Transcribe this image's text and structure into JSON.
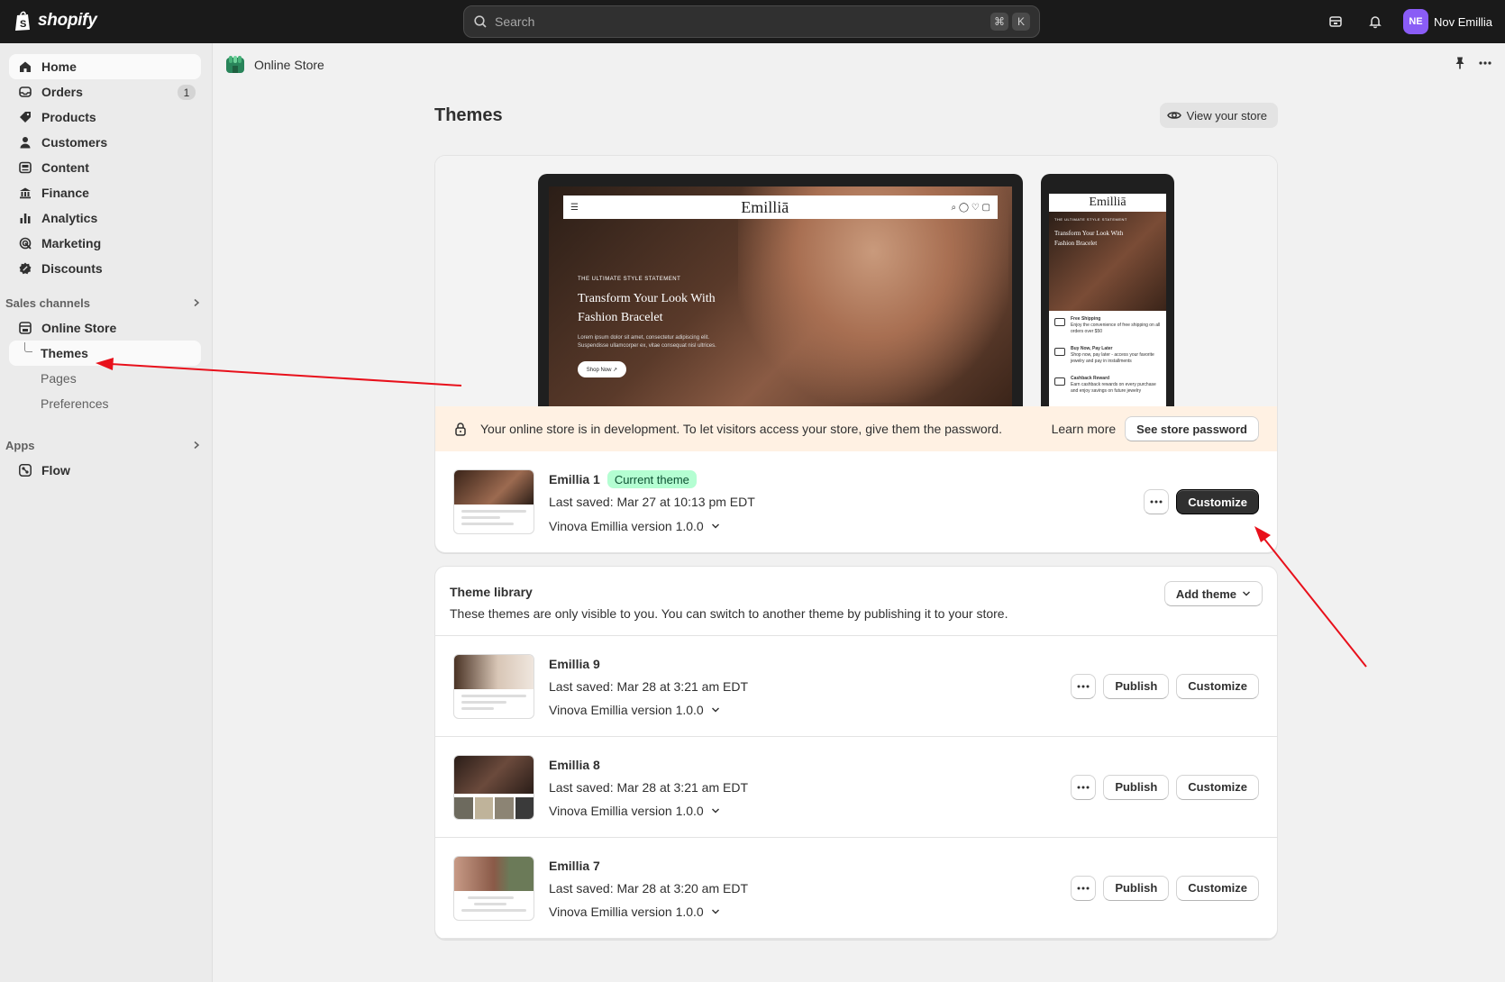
{
  "topbar": {
    "brand": "shopify",
    "search_placeholder": "Search",
    "shortcut_keys": [
      "⌘",
      "K"
    ],
    "user_initials": "NE",
    "user_name": "Nov Emillia",
    "avatar_color": "#8a5cf6"
  },
  "sidebar": {
    "items": [
      {
        "label": "Home",
        "icon": "home-icon"
      },
      {
        "label": "Orders",
        "icon": "orders-icon",
        "badge": "1"
      },
      {
        "label": "Products",
        "icon": "tag-icon"
      },
      {
        "label": "Customers",
        "icon": "person-icon"
      },
      {
        "label": "Content",
        "icon": "content-icon"
      },
      {
        "label": "Finance",
        "icon": "bank-icon"
      },
      {
        "label": "Analytics",
        "icon": "bar-chart-icon"
      },
      {
        "label": "Marketing",
        "icon": "target-icon"
      },
      {
        "label": "Discounts",
        "icon": "discount-icon"
      }
    ],
    "sales_channels_label": "Sales channels",
    "online_store_label": "Online Store",
    "sub_items": [
      "Themes",
      "Pages",
      "Preferences"
    ],
    "apps_label": "Apps",
    "apps": [
      "Flow"
    ]
  },
  "page_header": {
    "crumb": "Online Store"
  },
  "main": {
    "title": "Themes",
    "view_store_label": "View your store",
    "preview": {
      "brand": "Emilliā",
      "kicker": "THE ULTIMATE STYLE STATEMENT",
      "headline": "Transform Your Look With Fashion Bracelet",
      "body": "Lorem ipsum dolor sit amet, consectetur adipiscing elit. Suspendisse ullamcorper ex, vitae consequat nisl ultrices.",
      "shop_now": "Shop Now ↗",
      "phone_features": [
        {
          "title": "Free Shipping",
          "text": "Enjoy the convenience of free shipping on all orders over $50"
        },
        {
          "title": "Buy Now, Pay Later",
          "text": "Shop now, pay later - access your favorite jewelry and pay in installments"
        },
        {
          "title": "Cashback Reward",
          "text": "Earn cashback rewards on every purchase and enjoy savings on future jewelry"
        }
      ]
    },
    "dev_banner": {
      "text": "Your online store is in development. To let visitors access your store, give them the password.",
      "learn_more": "Learn more",
      "button": "See store password"
    },
    "current_theme": {
      "name": "Emillia 1",
      "badge": "Current theme",
      "saved": "Last saved: Mar 27 at 10:13 pm EDT",
      "version": "Vinova Emillia version 1.0.0",
      "customize_label": "Customize"
    },
    "library": {
      "title": "Theme library",
      "subtitle": "These themes are only visible to you. You can switch to another theme by publishing it to your store.",
      "add_theme_label": "Add theme",
      "publish_label": "Publish",
      "customize_label": "Customize",
      "themes": [
        {
          "name": "Emillia 9",
          "saved": "Last saved: Mar 28 at 3:21 am EDT",
          "version": "Vinova Emillia version 1.0.0"
        },
        {
          "name": "Emillia 8",
          "saved": "Last saved: Mar 28 at 3:21 am EDT",
          "version": "Vinova Emillia version 1.0.0"
        },
        {
          "name": "Emillia 7",
          "saved": "Last saved: Mar 28 at 3:20 am EDT",
          "version": "Vinova Emillia version 1.0.0"
        }
      ]
    }
  },
  "colors": {
    "topbar": "#1a1a1a",
    "sidebar": "#ebebeb",
    "banner": "#fff1e3",
    "badge_green": "#b4fed2",
    "annotation_arrow": "#e8101b"
  }
}
